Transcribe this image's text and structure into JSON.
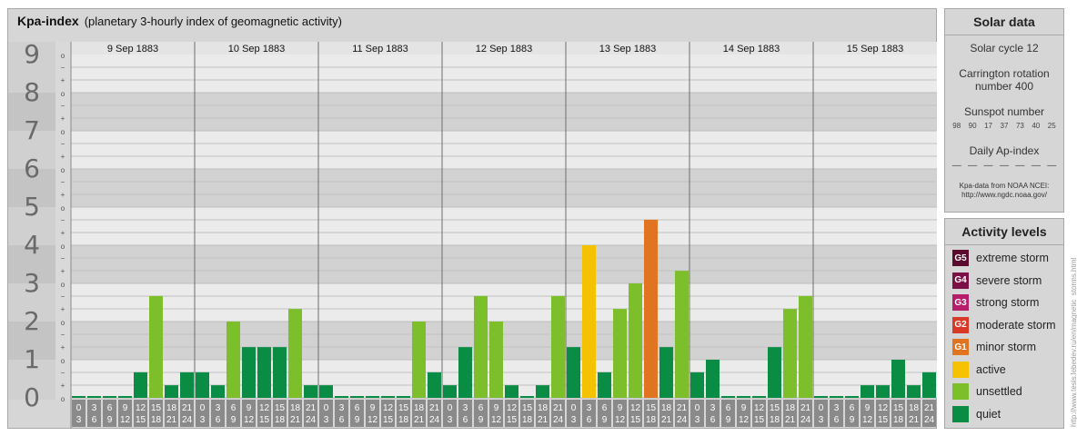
{
  "header": {
    "title": "Kpa-index",
    "subtitle": "(planetary 3-hourly index of geomagnetic activity)"
  },
  "chart_data": {
    "type": "bar",
    "title": "Kpa-index",
    "subtitle": "(planetary 3-hourly index of geomagnetic activity)",
    "ylim": [
      0,
      9
    ],
    "y_ticks": [
      "0",
      "1",
      "2",
      "3",
      "4",
      "5",
      "6",
      "7",
      "8",
      "9"
    ],
    "sub_ticks": [
      "o",
      "+",
      "−"
    ],
    "days": [
      "9 Sep 1883",
      "10 Sep 1883",
      "11 Sep 1883",
      "12 Sep 1883",
      "13 Sep 1883",
      "14 Sep 1883",
      "15 Sep 1883"
    ],
    "interval_labels": [
      [
        "0",
        "3"
      ],
      [
        "3",
        "6"
      ],
      [
        "6",
        "9"
      ],
      [
        "9",
        "12"
      ],
      [
        "12",
        "15"
      ],
      [
        "15",
        "18"
      ],
      [
        "18",
        "21"
      ],
      [
        "21",
        "24"
      ]
    ],
    "grid": true,
    "values": [
      [
        0.0,
        0.0,
        0.0,
        0.0,
        0.67,
        2.67,
        0.33,
        0.67
      ],
      [
        0.67,
        0.33,
        2.0,
        1.33,
        1.33,
        1.33,
        2.33,
        0.33
      ],
      [
        0.33,
        0.0,
        0.0,
        0.0,
        0.0,
        0.0,
        2.0,
        0.67
      ],
      [
        0.33,
        1.33,
        2.67,
        2.0,
        0.33,
        0.0,
        0.33,
        2.67
      ],
      [
        1.33,
        4.0,
        0.67,
        2.33,
        3.0,
        4.67,
        1.33,
        3.33
      ],
      [
        0.67,
        1.0,
        0.0,
        0.0,
        0.0,
        1.33,
        2.33,
        2.67
      ],
      [
        0.0,
        0.0,
        0.0,
        0.33,
        0.33,
        1.0,
        0.33,
        0.67
      ]
    ],
    "level_colors": {
      "quiet": "#0b8c45",
      "unsettled": "#7dbe2b",
      "active": "#f5c200",
      "minor": "#e17420"
    }
  },
  "solar": {
    "heading": "Solar data",
    "cycle": "Solar cycle 12",
    "carrington": "Carrington rotation number 400",
    "sunspot_heading": "Sunspot number",
    "sunspots": [
      "98",
      "90",
      "17",
      "37",
      "73",
      "40",
      "25"
    ],
    "ap_heading": "Daily Ap-index",
    "ap": [
      "—",
      "—",
      "—",
      "—",
      "—",
      "—",
      "—"
    ],
    "source_line1": "Kpa-data from NOAA NCEI:",
    "source_line2": "http://www.ngdc.noaa.gov/"
  },
  "levels": {
    "heading": "Activity levels",
    "items": [
      {
        "code": "G5",
        "label": "extreme storm",
        "color": "#5a0a2c"
      },
      {
        "code": "G4",
        "label": "severe storm",
        "color": "#7c1046"
      },
      {
        "code": "G3",
        "label": "strong storm",
        "color": "#b61e6c"
      },
      {
        "code": "G2",
        "label": "moderate storm",
        "color": "#d83a27"
      },
      {
        "code": "G1",
        "label": "minor storm",
        "color": "#e17420"
      },
      {
        "code": "",
        "label": "active",
        "color": "#f5c200"
      },
      {
        "code": "",
        "label": "unsettled",
        "color": "#7dbe2b"
      },
      {
        "code": "",
        "label": "quiet",
        "color": "#0b8c45"
      }
    ]
  },
  "watermark": "http://www.tesis.lebedev.ru/en/magnetic_storms.html"
}
